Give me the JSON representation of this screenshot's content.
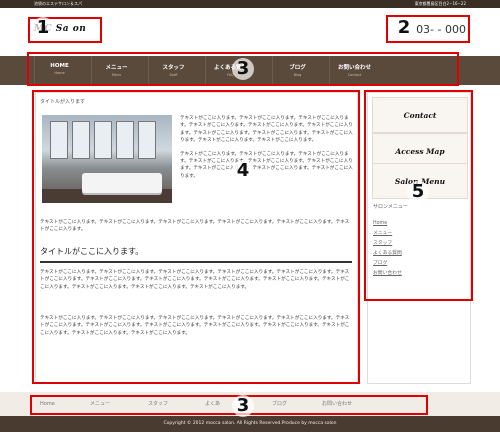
{
  "topbar": {
    "left": "池袋のエステサロン＆スパ",
    "right": "東京都豊島区目白2−16−22"
  },
  "header": {
    "logo": "MC     Sa  on",
    "phone": "03-      -    000"
  },
  "nav": [
    {
      "label": "HOME",
      "sub": "Home"
    },
    {
      "label": "メニュー",
      "sub": "Menu"
    },
    {
      "label": "スタッフ",
      "sub": "Staff"
    },
    {
      "label": "よくある質問",
      "sub": "FAQ"
    },
    {
      "label": "ブログ",
      "sub": "Blog"
    },
    {
      "label": "お問い合わせ",
      "sub": "Contact"
    }
  ],
  "main": {
    "breadcrumb": "タイトルが入ります",
    "para_right_1": "テキストがここに入ります。テキストがここに入ります。テキストがここに入ります。テキストがここに入ります。テキストがここに入ります。テキストがここに入ります。テキストがここに入ります。テキストがここに入ります。テキストがここに入ります。テキストがここに入ります。テキストがここに入ります。",
    "para_right_2": "テキストがここに入ります。テキストがここに入ります。テキストがここに入ります。テキストがここに入ります。テキストがここに入ります。テキストがここに入ります。テキストがここに入ります。テキストがここに入ります。テキストがここに入ります。",
    "para_full_1": "テキストがここに入ります。テキストがここに入ります。テキストがここに入ります。テキストがここに入ります。テキストがここに入ります。テキストがここに入ります。",
    "heading": "タイトルがここに入ります。",
    "para_2": "テキストがここに入ります。テキストがここに入ります。テキストがここに入ります。テキストがここに入ります。テキストがここに入ります。テキストがここに入ります。テキストがここに入ります。テキストがここに入ります。テキストがここに入ります。テキストがここに入ります。テキストがここに入ります。テキストがここに入ります。テキストがここに入ります。テキストがここに入ります。",
    "para_3": "テキストがここに入ります。テキストがここに入ります。テキストがここに入ります。テキストがここに入ります。テキストがここに入ります。テキストがここに入ります。テキストがここに入ります。テキストがここに入ります。テキストがここに入ります。テキストがここに入ります。テキストがここに入ります。テキストがここに入ります。テキストがここに入ります。"
  },
  "sidebar": {
    "buttons": [
      "Contact",
      "Access Map",
      "Salon Menu"
    ],
    "heading": "サロンメニュー",
    "links": [
      "Home",
      "メニュー",
      "スタッフ",
      "よくある質問",
      "ブログ",
      "お問い合わせ"
    ]
  },
  "footer": {
    "links": [
      "Home",
      "メニュー",
      "スタッフ",
      "よくあ",
      "ブログ",
      "お問い合わせ"
    ],
    "copyright": "Copyright © 2012 mocca salon. All Rights Reserved.Produce by mocca salon"
  },
  "annotations": [
    "1",
    "2",
    "3",
    "4",
    "5",
    "3"
  ],
  "colors": {
    "nav_bg": "#5a4a3c",
    "highlight": "#e00000",
    "footer_bg": "#4a3b30"
  }
}
